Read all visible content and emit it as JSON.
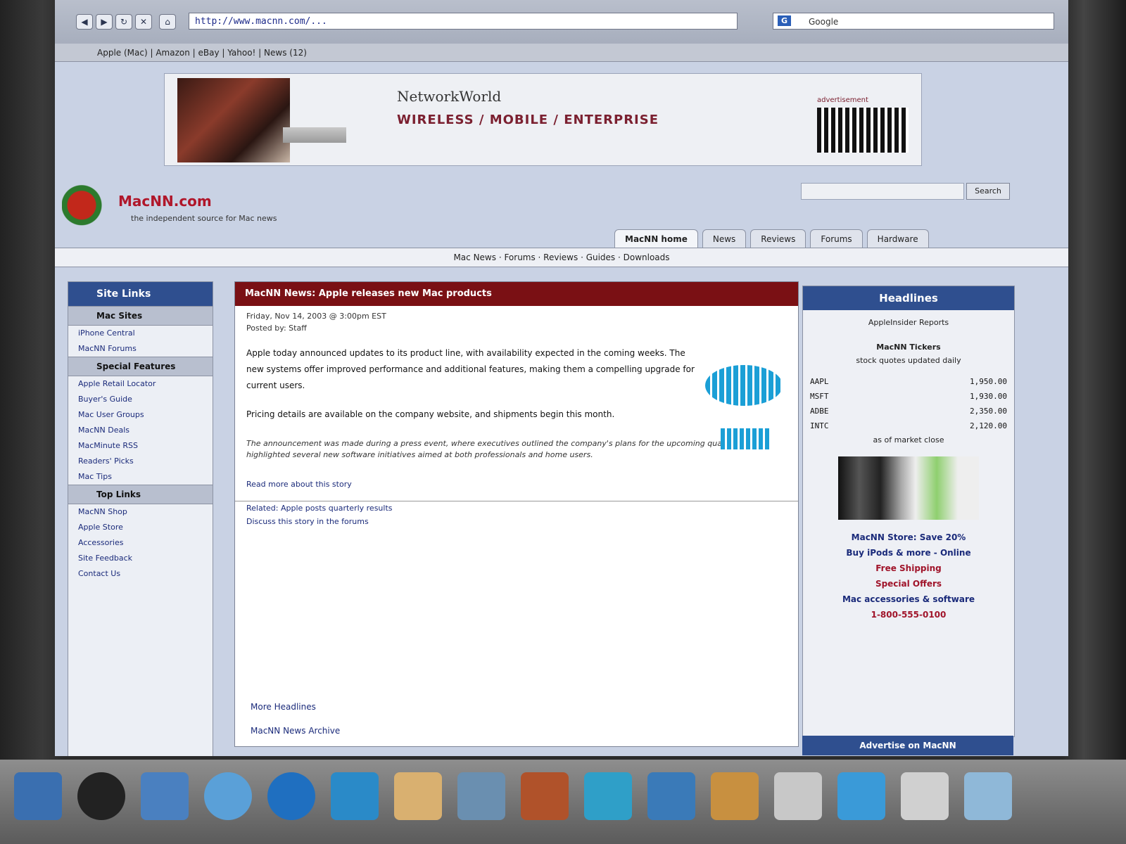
{
  "browser": {
    "back_label": "◀",
    "forward_label": "▶",
    "reload_label": "↻",
    "stop_label": "✕",
    "home_label": "⌂",
    "url": "http://www.macnn.com/...",
    "search_engine_badge": "G",
    "search_placeholder": "Google",
    "bookmarks_text": "Apple (Mac) | Amazon | eBay | Yahoo! | News (12)"
  },
  "banner": {
    "title": "NetworkWorld",
    "subtitle": "WIRELESS / MOBILE / ENTERPRISE",
    "ad_label": "advertisement"
  },
  "site": {
    "name": "MacNN.com",
    "tagline": "the independent source for Mac news",
    "search_button": "Search"
  },
  "tabs": [
    "MacNN home",
    "News",
    "Reviews",
    "Forums",
    "Hardware"
  ],
  "crumb_text": "Mac News · Forums · Reviews · Guides · Downloads",
  "left_sidebar": {
    "header": "Site Links",
    "sub1": "Mac Sites",
    "links1": [
      "iPhone Central",
      "MacNN Forums"
    ],
    "sub2": "Special Features",
    "links2": [
      "Apple Retail Locator",
      "Buyer's Guide",
      "Mac User Groups",
      "MacNN Deals",
      "MacMinute RSS",
      "Readers' Picks",
      "Mac Tips"
    ],
    "sub3": "Top Links",
    "links3": [
      "MacNN Shop",
      "Apple Store",
      "Accessories",
      "Site Feedback",
      "Contact Us"
    ]
  },
  "article": {
    "title": "MacNN News: Apple releases new Mac products",
    "byline": "Friday, Nov 14, 2003 @ 3:00pm EST",
    "posted": "Posted by: Staff",
    "para1": "Apple today announced updates to its product line, with availability expected in the coming weeks. The new systems offer improved performance and additional features, making them a compelling upgrade for current users.",
    "para2": "Pricing details are available on the company website, and shipments begin this month.",
    "para3": "The announcement was made during a press event, where executives outlined the company's plans for the upcoming quarter and highlighted several new software initiatives aimed at both professionals and home users.",
    "link1": "Read more about this story",
    "comment1": "Related: Apple posts quarterly results",
    "comment2": "Discuss this story in the forums",
    "below1": "More Headlines",
    "below2": "MacNN News Archive"
  },
  "right_sidebar": {
    "header": "Headlines",
    "line1": "AppleInsider Reports",
    "sub_header": "MacNN Tickers",
    "sub_line": "stock quotes updated daily",
    "stocks": [
      {
        "sym": "AAPL",
        "val": "1,950.00"
      },
      {
        "sym": "MSFT",
        "val": "1,930.00"
      },
      {
        "sym": "ADBE",
        "val": "2,350.00"
      },
      {
        "sym": "INTC",
        "val": "2,120.00"
      }
    ],
    "stock_note": "as of market close",
    "promo1": "MacNN Store: Save 20%",
    "promo2": "Buy iPods & more - Online",
    "promo3": "Free Shipping",
    "promo4": "Special Offers",
    "promo5": "Mac accessories & software",
    "promo6": "1-800-555-0100",
    "footer": "Advertise on MacNN"
  },
  "colors": {
    "title_bar": "#7a1014",
    "sidebar_header": "#2f4f8f"
  },
  "icons": [
    "back-icon",
    "forward-icon",
    "reload-icon",
    "stop-icon",
    "home-icon",
    "search-icon"
  ]
}
